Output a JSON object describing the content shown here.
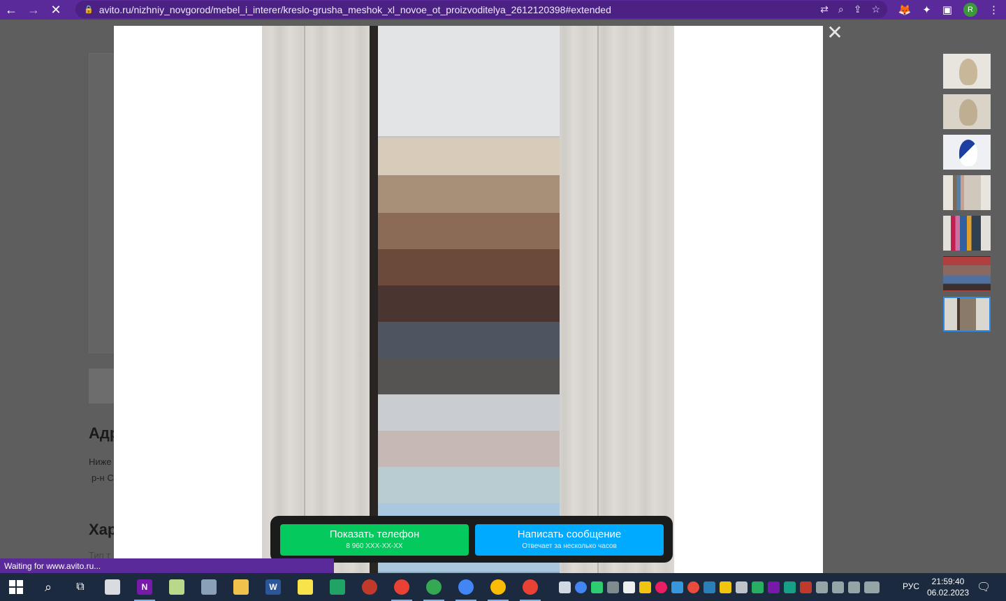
{
  "browser": {
    "url": "avito.ru/nizhniy_novgorod/mebel_i_interer/kreslo-grusha_meshok_xl_novoe_ot_proizvoditelya_2612120398#extended",
    "profile_initial": "R",
    "accent_color": "#5a2a9a"
  },
  "background_page": {
    "heading_address": "Адр",
    "address_line1": "Ниже",
    "address_line2": "р-н С",
    "heading_characteristics": "Хар",
    "truncated_text": "Тип т"
  },
  "cta": {
    "phone_button": "Показать телефон",
    "phone_number": "8 960 XXX-XX-XX",
    "message_button": "Написать сообщение",
    "message_sub": "Отвечает за несколько часов",
    "green": "#04c95c",
    "blue": "#00aaff"
  },
  "thumbnails_count": 7,
  "active_thumbnail": 7,
  "status_bar": "Waiting for www.avito.ru...",
  "taskbar": {
    "language": "РУС",
    "time": "21:59:40",
    "date": "06.02.2023"
  }
}
